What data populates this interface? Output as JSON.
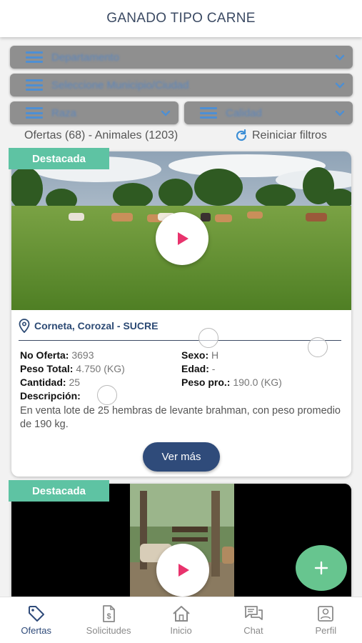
{
  "header": {
    "title": "GANADO TIPO CARNE"
  },
  "filters": [
    {
      "label": "Departamento"
    },
    {
      "label": "Seleccione Municipio/Ciudad"
    },
    {
      "label": "Raza"
    },
    {
      "label": "Calidad"
    }
  ],
  "summary": {
    "text": "Ofertas (68) - Animales (1203)",
    "reset_label": "Reiniciar filtros"
  },
  "offers": [
    {
      "badge": "Destacada",
      "location": "Corneta, Corozal - SUCRE",
      "no_oferta_label": "No Oferta:",
      "no_oferta": "3693",
      "sexo_label": "Sexo:",
      "sexo": "H",
      "peso_total_label": "Peso Total:",
      "peso_total": "4.750 (KG)",
      "edad_label": "Edad:",
      "edad": "-",
      "cantidad_label": "Cantidad:",
      "cantidad": "25",
      "peso_pro_label": "Peso pro.:",
      "peso_pro": "190.0 (KG)",
      "descripcion_label": "Descripción:",
      "descripcion": "En venta lote de 25 hembras de levante brahman, con peso promedio de 190 kg.",
      "button": "Ver más"
    },
    {
      "badge": "Destacada"
    }
  ],
  "nav": [
    {
      "label": "Ofertas",
      "icon": "tag-icon",
      "active": true
    },
    {
      "label": "Solicitudes",
      "icon": "dollar-document-icon"
    },
    {
      "label": "Inicio",
      "icon": "home-icon"
    },
    {
      "label": "Chat",
      "icon": "chat-icon"
    },
    {
      "label": "Perfil",
      "icon": "profile-icon"
    }
  ],
  "colors": {
    "brand": "#2f4b7a",
    "badge": "#5ec3a3",
    "fab": "#67c58f",
    "play": "#e8336d"
  }
}
